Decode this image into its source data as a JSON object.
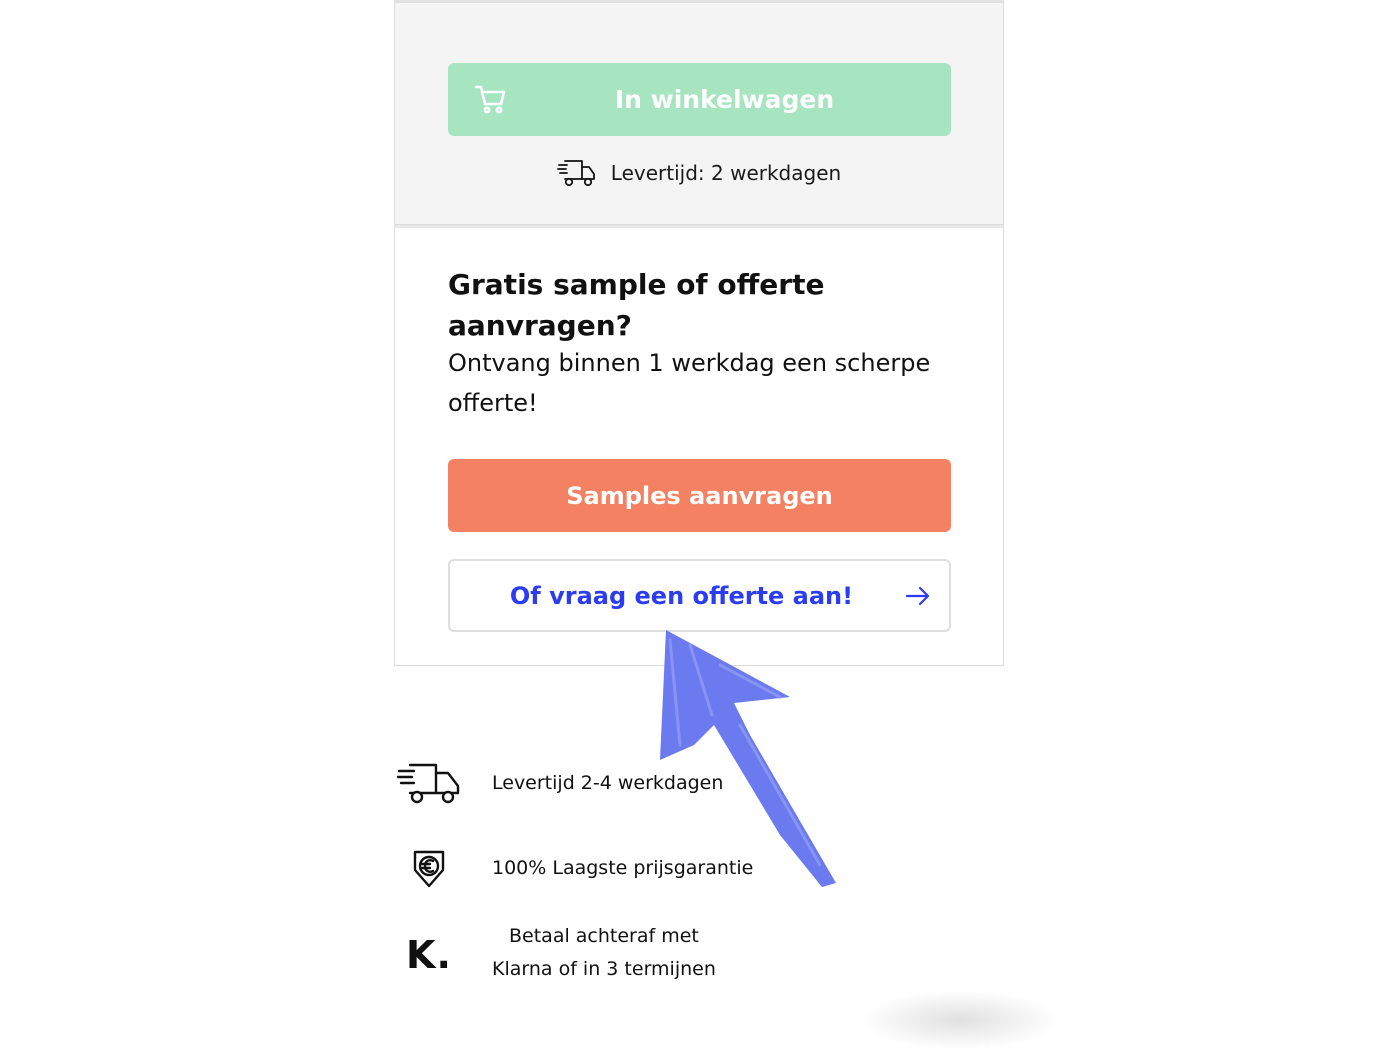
{
  "cart": {
    "button_label": "In winkelwagen",
    "delivery_text": "Levertijd: 2 werkdagen"
  },
  "sample_offer": {
    "heading": "Gratis sample of offerte aanvragen?",
    "subtext": "Ontvang binnen 1 werkdag een scherpe offerte!",
    "samples_button": "Samples aanvragen",
    "quote_button": "Of vraag een offerte aan!"
  },
  "features": [
    {
      "icon": "delivery-truck-icon",
      "text": "Levertijd 2-4 werkdagen"
    },
    {
      "icon": "euro-price-tag-icon",
      "text": "100% Laagste prijsgarantie"
    },
    {
      "icon": "klarna-logo",
      "text_line1": "Betaal achteraf met",
      "text_line2": "Klarna of in 3 termijnen",
      "logo_text": "K."
    }
  ],
  "colors": {
    "cart_button": "#a6e5c0",
    "samples_button": "#f48262",
    "quote_text": "#2b3df0",
    "annotation_arrow": "#6b7bef"
  }
}
